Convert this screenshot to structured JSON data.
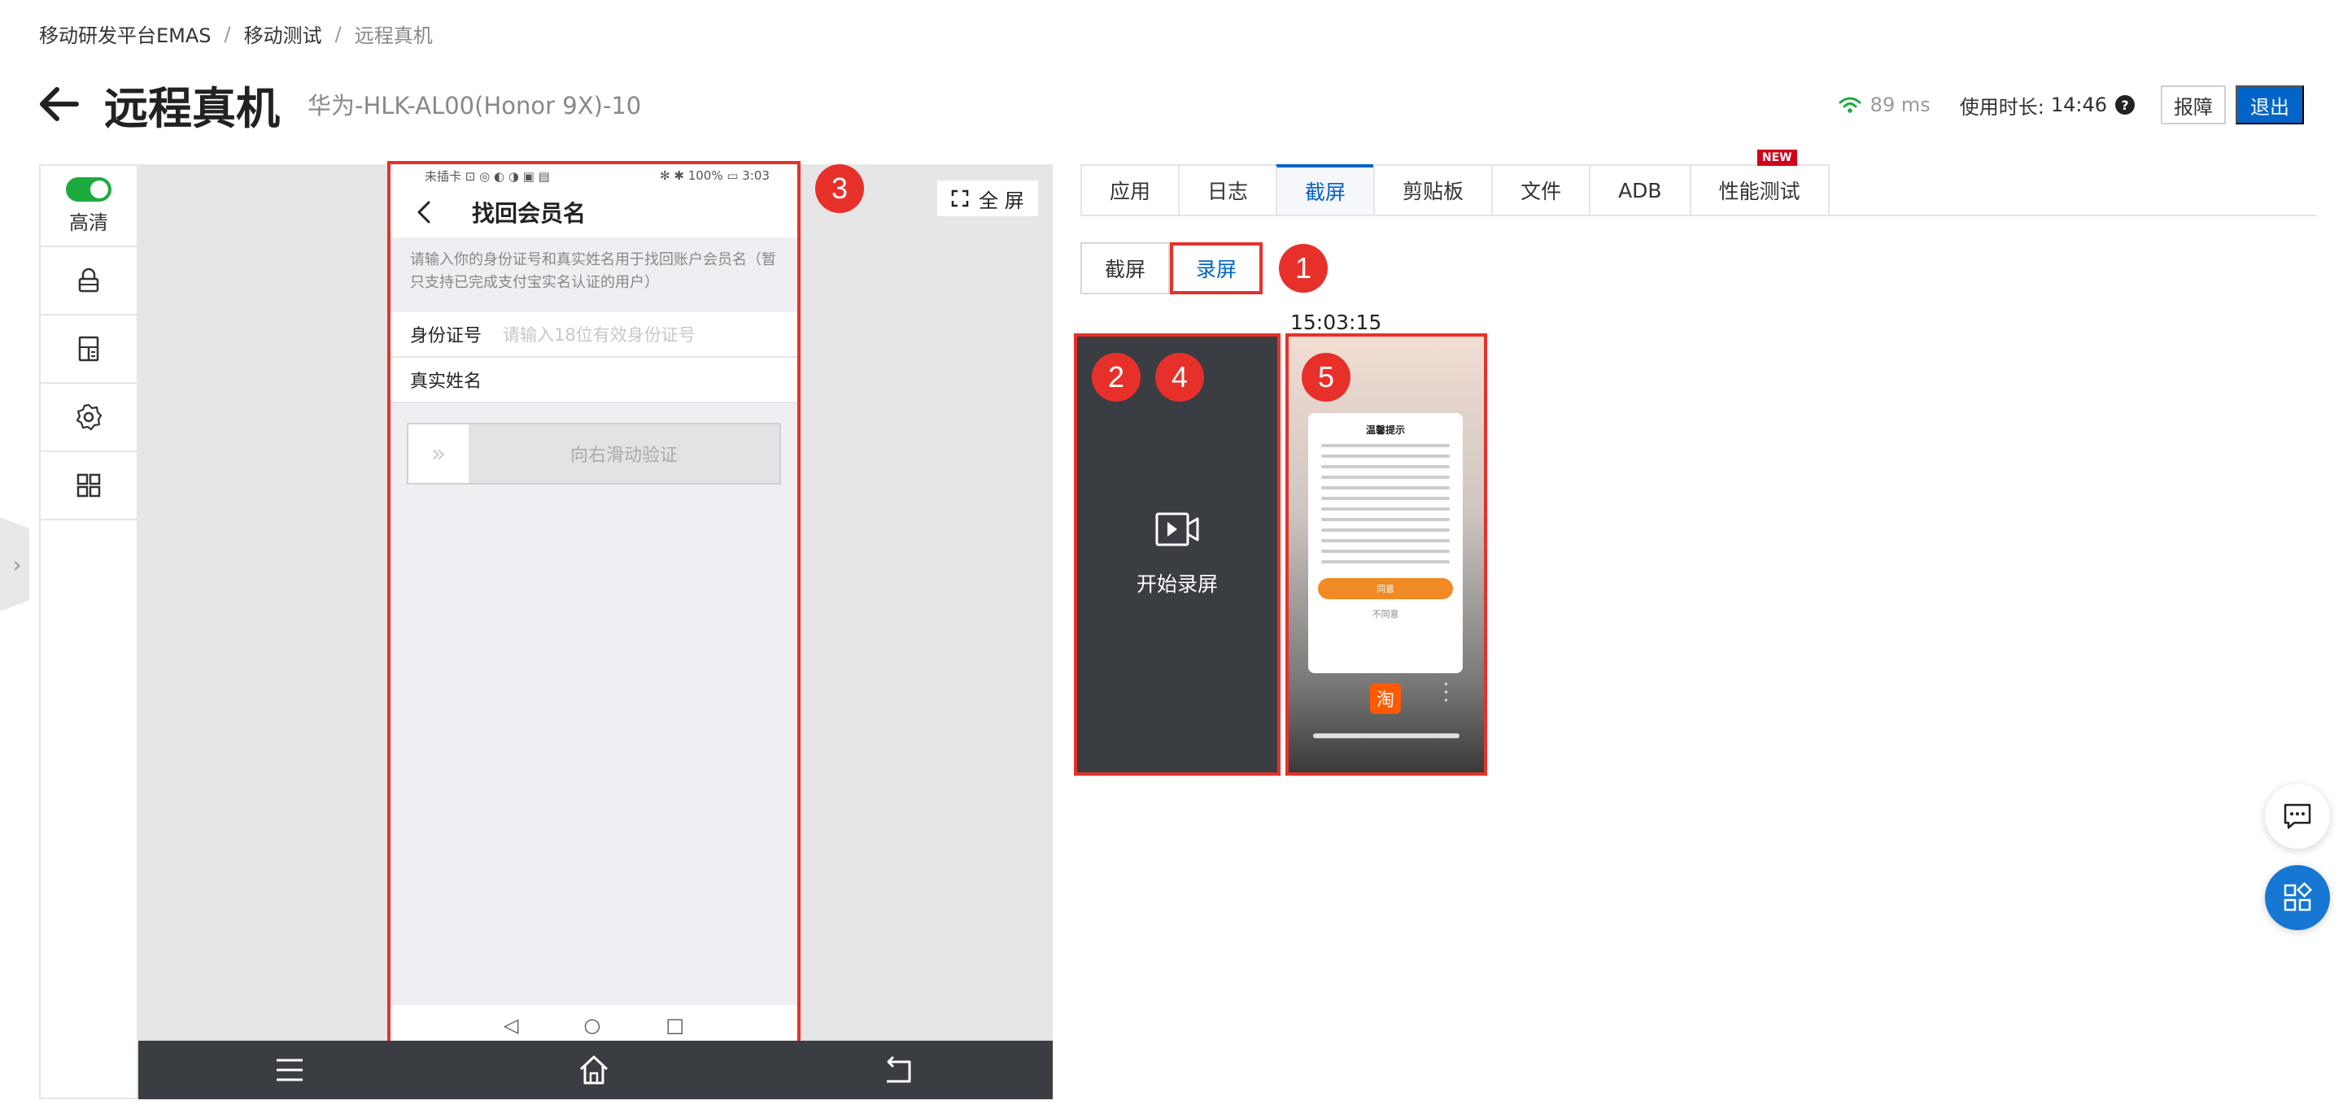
{
  "breadcrumb": {
    "items": [
      "移动研发平台EMAS",
      "移动测试",
      "远程真机"
    ],
    "separator": "/"
  },
  "header": {
    "title": "远程真机",
    "device": "华为-HLK-AL00(Honor 9X)-10"
  },
  "status": {
    "latency": "89 ms",
    "usage_label": "使用时长:",
    "usage_time": "14:46",
    "help": "?",
    "report_label": "报障",
    "exit_label": "退出"
  },
  "sidebar": {
    "hd_label": "高清",
    "icons": [
      "lock-icon",
      "device-info-icon",
      "gear-icon",
      "grid-icon"
    ]
  },
  "stage": {
    "fullscreen_label": "全 屏"
  },
  "phone": {
    "status_left": "未插卡 ⊡ ◎ ◐ ◑ ▣ ▤",
    "status_right": "✻ ✱ 100% ▭ 3:03",
    "nav_title": "找回会员名",
    "description": "请输入你的身份证号和真实姓名用于找回账户会员名（暂只支持已完成支付宝实名认证的用户）",
    "id_label": "身份证号",
    "id_placeholder": "请输入18位有效身份证号",
    "name_label": "真实姓名",
    "slider_knob": "»",
    "slider_text": "向右滑动验证",
    "nav_back": "◁",
    "nav_home": "○",
    "nav_recent": "□"
  },
  "tabs": {
    "items": [
      "应用",
      "日志",
      "截屏",
      "剪贴板",
      "文件",
      "ADB",
      "性能测试"
    ],
    "active_index": 2,
    "new_badge": "NEW"
  },
  "subtabs": {
    "items": [
      "截屏",
      "录屏"
    ],
    "active_index": 1
  },
  "recording": {
    "start_label": "开始录屏",
    "time": "15:03:15"
  },
  "thumbnail": {
    "dialog_title": "温馨提示",
    "agree": "同意",
    "disagree": "不同意",
    "logo": "淘"
  },
  "badges": [
    "1",
    "2",
    "3",
    "4",
    "5"
  ],
  "colors": {
    "accent": "#0064c8",
    "annotation": "#e8302a",
    "toggle_on": "#1dab3f",
    "dark_panel": "#3a3d42",
    "fab": "#1677d2"
  }
}
